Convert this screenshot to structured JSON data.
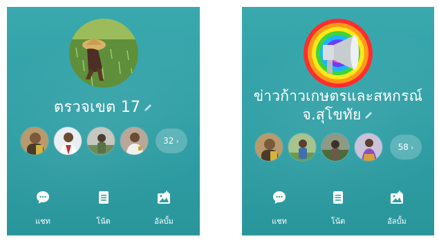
{
  "profiles": [
    {
      "name": "ตรวจเขต 17",
      "members_more": "32",
      "actions": [
        {
          "label": "แชท",
          "icon": "chat-bubble-icon"
        },
        {
          "label": "โน้ต",
          "icon": "note-icon"
        },
        {
          "label": "อัลบั้ม",
          "icon": "album-icon"
        }
      ]
    },
    {
      "name": "ข่าวก้าวเกษตรและสหกรณ์ จ.สุโขทัย",
      "members_more": "58",
      "actions": [
        {
          "label": "แชท",
          "icon": "chat-bubble-icon"
        },
        {
          "label": "โน้ต",
          "icon": "note-icon"
        },
        {
          "label": "อัลบั้ม",
          "icon": "album-icon"
        }
      ]
    }
  ]
}
